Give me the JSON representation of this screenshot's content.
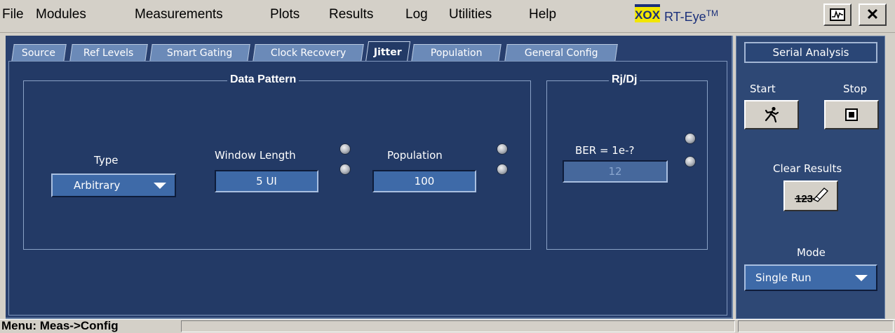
{
  "menu": {
    "items": [
      "File",
      "Modules",
      "Measurements",
      "Plots",
      "Results",
      "Log",
      "Utilities",
      "Help"
    ]
  },
  "brand": {
    "name": "RT-Eye",
    "tm": "TM",
    "logo_text": "XOX"
  },
  "title_buttons": {
    "minimize_icon": "waveform-restore-icon",
    "close": "✕"
  },
  "tabs": [
    {
      "label": "Source",
      "active": false
    },
    {
      "label": "Ref Levels",
      "active": false
    },
    {
      "label": "Smart Gating",
      "active": false
    },
    {
      "label": "Clock Recovery",
      "active": false
    },
    {
      "label": "Jitter",
      "active": true
    },
    {
      "label": "Population",
      "active": false
    },
    {
      "label": "General Config",
      "active": false
    }
  ],
  "data_pattern": {
    "title": "Data Pattern",
    "type_label": "Type",
    "type_value": "Arbitrary",
    "window_length_label": "Window Length",
    "window_length_value": "5 UI",
    "population_label": "Population",
    "population_value": "100"
  },
  "rjdj": {
    "title": "Rj/Dj",
    "ber_label": "BER = 1e-?",
    "ber_value": "12"
  },
  "side": {
    "title": "Serial Analysis",
    "start_label": "Start",
    "stop_label": "Stop",
    "clear_results_label": "Clear Results",
    "clear_icon_text": "123",
    "mode_label": "Mode",
    "mode_value": "Single Run"
  },
  "status": {
    "text": "Menu: Meas->Config"
  },
  "colors": {
    "panel_bg": "#233a66",
    "field_bg": "#3e6aa8",
    "tab_bg": "#6b8ab8",
    "chrome": "#d4d0c8"
  }
}
